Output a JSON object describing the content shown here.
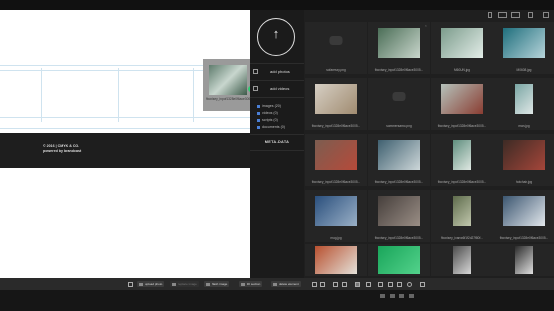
{
  "footer": {
    "line1": "© 2016  |  CMYK & CO.",
    "line2": "powered by brandcast"
  },
  "drag_preview": {
    "caption": "fboxisey_inpof1328e0f6ace3005..."
  },
  "side": {
    "upload_icon": "upload-arrow-icon",
    "add_photos": "add photos",
    "add_videos": "add videos",
    "counts": [
      "images (20)",
      "videos (0)",
      "scripts (0)",
      "documents (0)"
    ],
    "metadata": "META-DATA"
  },
  "gallery": [
    {
      "label": "sofaresxy.png",
      "kind": "placeholder",
      "colors": []
    },
    {
      "label": "fboxisey_inpof1328e0f6ace3005...",
      "kind": "image",
      "colors": [
        "#4b6e57",
        "#c9d6cc"
      ]
    },
    {
      "label": "M60UN.jpg",
      "kind": "image",
      "colors": [
        "#7c9c8c",
        "#e3ede8"
      ]
    },
    {
      "label": "M0608.jpg",
      "kind": "image",
      "colors": [
        "#1f6f7d",
        "#b7d4da"
      ]
    },
    {
      "label": "fboxisey_inpof1328e0f6ace3005...",
      "kind": "image",
      "colors": [
        "#d6cfc4",
        "#a08b70"
      ]
    },
    {
      "label": "sommersamo.png",
      "kind": "placeholder",
      "colors": []
    },
    {
      "label": "fboxisey_inpof1328e0f6ace3005...",
      "kind": "image",
      "colors": [
        "#b5c2bb",
        "#8a3d32"
      ]
    },
    {
      "label": "man.jpg",
      "kind": "image",
      "colors": [
        "#7aa6a4",
        "#dfe7e6"
      ]
    },
    {
      "label": "fboxisey_inpof1328e0f6ace3005...",
      "kind": "image",
      "colors": [
        "#7c5d50",
        "#b64a3a"
      ]
    },
    {
      "label": "fboxisey_inpof1328e0f6ace3005...",
      "kind": "image",
      "colors": [
        "#3f6070",
        "#cdd7d9"
      ]
    },
    {
      "label": "fboxisey_inpof1328e0f6ace3005...",
      "kind": "image",
      "colors": [
        "#5f8e7e",
        "#dfe8e2"
      ]
    },
    {
      "label": "hotchair.jpg",
      "kind": "image",
      "colors": [
        "#3d2b25",
        "#a5463a"
      ]
    },
    {
      "label": "mug.jpg",
      "kind": "image",
      "colors": [
        "#2a4f7d",
        "#9ab0c6"
      ]
    },
    {
      "label": "fboxisey_inpof1328e0f6ace3005...",
      "kind": "image",
      "colors": [
        "#463f3c",
        "#9a8e85"
      ]
    },
    {
      "label": "fboxisey_ivanw6f1f2d27f80f...",
      "kind": "image",
      "colors": [
        "#5e6b4b",
        "#c0c7ad"
      ]
    },
    {
      "label": "fboxisey_inpof1328e0f6ace3005...",
      "kind": "image",
      "colors": [
        "#3b5670",
        "#e2e7ec"
      ]
    },
    {
      "label": "",
      "kind": "image",
      "colors": [
        "#b8502f",
        "#e4e1d9"
      ]
    },
    {
      "label": "",
      "kind": "image",
      "colors": [
        "#19a55a",
        "#53d28b"
      ]
    },
    {
      "label": "",
      "kind": "image",
      "colors": [
        "#4a4a4a",
        "#d8d8d8"
      ]
    },
    {
      "label": "",
      "kind": "image",
      "colors": [
        "#2a2a2a",
        "#e0e0e0"
      ]
    }
  ],
  "toolbar": {
    "buttons": [
      "upload photo",
      "replace image",
      "flash image",
      "lift section",
      "delete element"
    ]
  },
  "colors": {
    "accent": "#2ecc71",
    "bg_dark": "#1f1f1f",
    "panel": "#1b1b1b"
  }
}
